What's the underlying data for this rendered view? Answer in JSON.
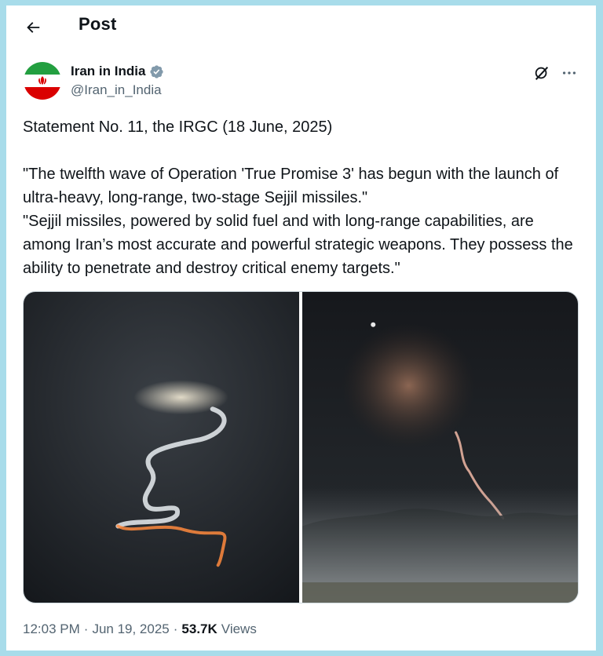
{
  "header": {
    "title": "Post",
    "back_icon": "arrow-left-icon"
  },
  "author": {
    "display_name": "Iran in India",
    "handle": "@Iran_in_India",
    "verified_icon": "verified-badge-icon",
    "avatar_icon": "iran-flag-avatar"
  },
  "actions": {
    "grok_icon": "grok-icon",
    "more_icon": "more-horizontal-icon"
  },
  "tweet": {
    "line1": "Statement No. 11, the IRGC (18 June, 2025)",
    "paragraph2": "\"The twelfth wave of Operation 'True Promise 3' has begun with the launch of ultra-heavy, long-range, two-stage Sejjil missiles.\"",
    "paragraph3": "\"Sejjil missiles, powered by solid fuel and with long-range capabilities, are among Iran’s most accurate and powerful strategic weapons. They possess the ability to penetrate and destroy critical enemy targets.\""
  },
  "media": [
    {
      "kind": "photo",
      "icon": "missile-trail-photo-1"
    },
    {
      "kind": "photo",
      "icon": "missile-trail-photo-2"
    }
  ],
  "meta": {
    "time": "12:03 PM",
    "separator": "·",
    "date": "Jun 19, 2025",
    "views_count": "53.7K",
    "views_label": "Views"
  },
  "colors": {
    "background": "#a8dcea",
    "text_primary": "#0f1419",
    "text_secondary": "#536471",
    "verified_badge": "#829aab",
    "flag_green": "#239f40",
    "flag_red": "#da0000"
  }
}
